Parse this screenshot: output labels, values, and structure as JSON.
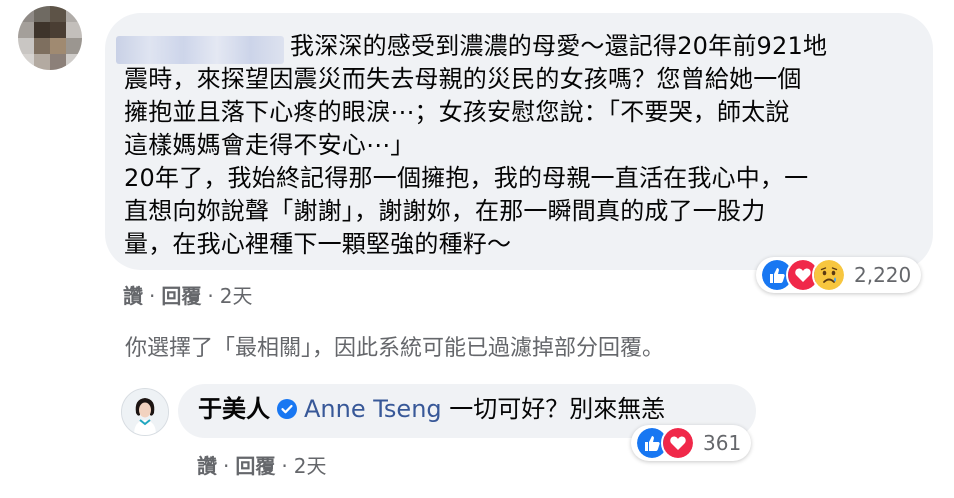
{
  "comment": {
    "lines": [
      "我深深的感受到濃濃的母愛～還記得20年前921地",
      "震時，來探望因震災而失去母親的災民的女孩嗎？您曾給她一個",
      "擁抱並且落下心疼的眼淚⋯；女孩安慰您說：「不要哭，師太說",
      "這樣媽媽會走得不安心⋯」",
      "20年了，我始終記得那一個擁抱，我的母親一直活在我心中，一",
      "直想向妳說聲「謝謝」，謝謝妳，在那一瞬間真的成了一股力",
      "量，在我心裡種下一顆堅強的種籽～"
    ],
    "actions": {
      "like": "讚",
      "reply": "回覆",
      "dot": "·",
      "time": "2天"
    },
    "reaction_count": "2,220",
    "reaction_icons": [
      "like-icon",
      "love-icon",
      "sad-icon"
    ]
  },
  "filter_notice": "你選擇了「最相關」，因此系統可能已過濾掉部分回覆。",
  "reply": {
    "author": "于美人",
    "tagged_user": "Anne Tseng",
    "text": " 一切可好？別來無恙",
    "actions": {
      "like": "讚",
      "reply": "回覆",
      "dot": "·",
      "time": "2天"
    },
    "reaction_count": "361",
    "reaction_icons": [
      "like-icon",
      "love-icon"
    ]
  },
  "colors": {
    "bubble": "#f0f2f5",
    "secondary_text": "#65676b",
    "link": "#385898",
    "like_blue": "#1877f2",
    "love_red": "#f02849",
    "verified_blue": "#1877f2"
  }
}
